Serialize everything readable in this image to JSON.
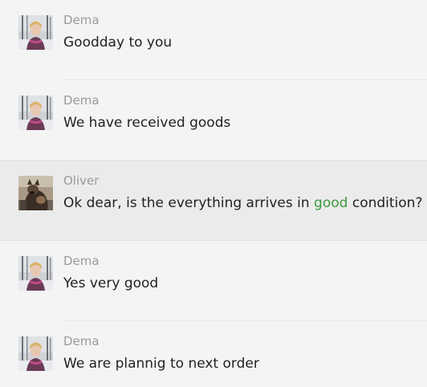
{
  "messages": [
    {
      "sender": "Dema",
      "text": "Goodday to you",
      "avatar": "avatar-dema-snow-photo"
    },
    {
      "sender": "Dema",
      "text": "We have received goods",
      "avatar": "avatar-dema-snow-photo"
    },
    {
      "sender": "Oliver",
      "text_before": "Ok dear, is the everything arrives in ",
      "text_highlight": "good",
      "text_after": " condition?",
      "avatar": "avatar-oliver-dog-photo",
      "selected": true,
      "highlight_color": "#3a9a3a"
    },
    {
      "sender": "Dema",
      "text": "Yes very good",
      "avatar": "avatar-dema-snow-photo"
    },
    {
      "sender": "Dema",
      "text": "We are plannig to next order",
      "avatar": "avatar-dema-snow-photo"
    }
  ],
  "colors": {
    "background": "#f4f4f4",
    "selected_background": "#ebebeb",
    "sender": "#9a9a9a",
    "text": "#222222"
  }
}
